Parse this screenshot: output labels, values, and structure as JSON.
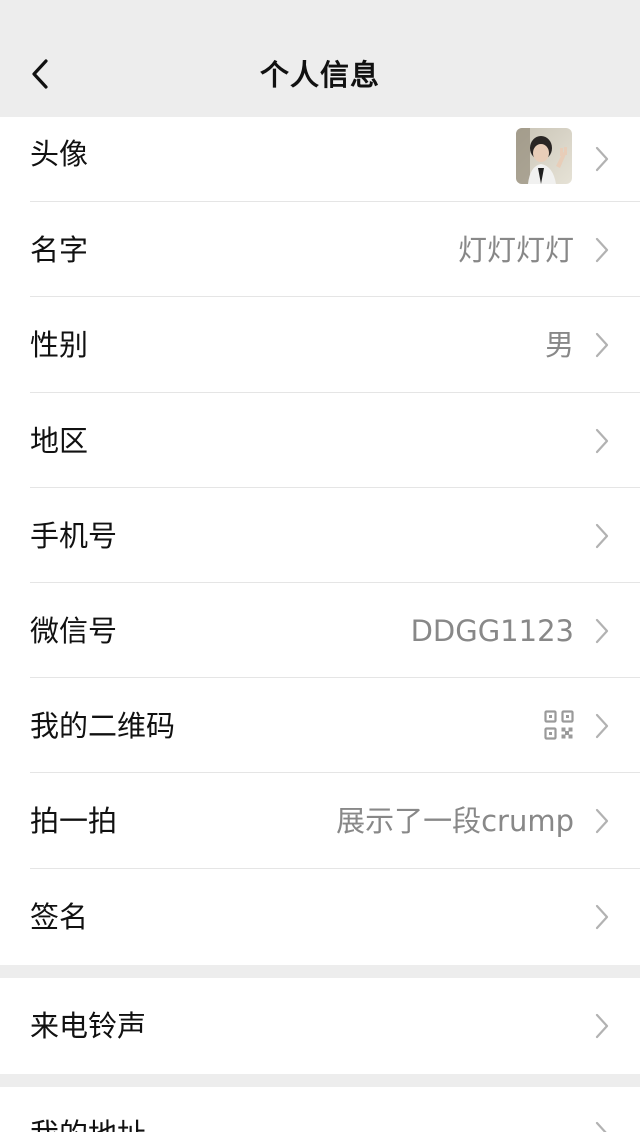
{
  "header": {
    "title": "个人信息",
    "back_icon": "chevron-left-icon"
  },
  "rows": [
    {
      "label": "头像",
      "value": "",
      "kind": "avatar"
    },
    {
      "label": "名字",
      "value": "灯灯灯灯"
    },
    {
      "label": "性别",
      "value": "男"
    },
    {
      "label": "地区",
      "value": ""
    },
    {
      "label": "手机号",
      "value": ""
    },
    {
      "label": "微信号",
      "value": "DDGG1123"
    },
    {
      "label": "我的二维码",
      "value": "",
      "kind": "qr"
    },
    {
      "label": "拍一拍",
      "value": "展示了一段crump"
    },
    {
      "label": "签名",
      "value": ""
    }
  ],
  "group2": [
    {
      "label": "来电铃声",
      "value": ""
    }
  ],
  "group3": [
    {
      "label": "我的地址",
      "value": ""
    }
  ],
  "colors": {
    "background": "#ededed",
    "card": "#ffffff",
    "label_text": "#111111",
    "value_text": "#888888",
    "chevron": "#b2b2b2",
    "divider": "#e5e5e5"
  }
}
